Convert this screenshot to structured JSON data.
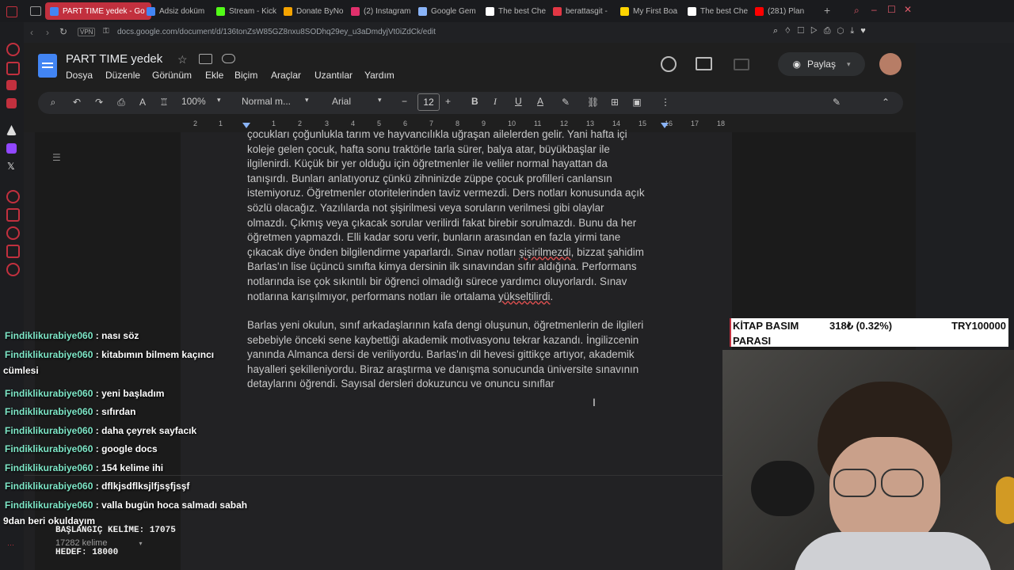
{
  "browser": {
    "tabs": [
      {
        "label": "PART TIME yedek - Go",
        "active": true,
        "color": "#4285f4"
      },
      {
        "label": "Adsiz doküm",
        "color": "#4285f4"
      },
      {
        "label": "Stream - Kick",
        "color": "#53fc18"
      },
      {
        "label": "Donate ByNo",
        "color": "#f4a300"
      },
      {
        "label": "(2) Instagram",
        "color": "#e1306c"
      },
      {
        "label": "Google Gem",
        "color": "#8ab4f8"
      },
      {
        "label": "The best Che",
        "color": "#ffffff"
      },
      {
        "label": "berattasgit -",
        "color": "#e23744"
      },
      {
        "label": "My First Boa",
        "color": "#ffd400"
      },
      {
        "label": "The best Che",
        "color": "#ffffff"
      },
      {
        "label": "(281) Plan",
        "color": "#ff0000"
      }
    ],
    "vpn": "VPN",
    "url": "docs.google.com/document/d/136tonZsW85GZ8nxu8SODhq29ey_u3aDmdyjVt0iZdCk/edit"
  },
  "docs": {
    "title": "PART TIME yedek",
    "menu": [
      "Dosya",
      "Düzenle",
      "Görünüm",
      "Ekle",
      "Biçim",
      "Araçlar",
      "Uzantılar",
      "Yardım"
    ],
    "share_label": "Paylaş",
    "toolbar": {
      "zoom": "100%",
      "style": "Normal m...",
      "font": "Arial",
      "font_size": "12"
    },
    "ruler": [
      "2",
      "1",
      "1",
      "2",
      "3",
      "4",
      "5",
      "6",
      "7",
      "8",
      "9",
      "10",
      "11",
      "12",
      "13",
      "14",
      "15",
      "16",
      "17",
      "18"
    ],
    "paragraph1": [
      "çocukları çoğunlukla tarım ve hayvancılıkla uğraşan ailelerden gelir. Yani hafta içi",
      "koleje gelen çocuk, hafta sonu traktörle tarla sürer, balya atar, büyükbaşlar ile",
      "ilgilenirdi. Küçük bir yer olduğu için öğretmenler ile veliler normal hayattan da",
      "tanışırdı. Bunları anlatıyoruz çünkü zihninizde züppe çocuk profilleri canlansın",
      "istemiyoruz. Öğretmenler otoritelerinden taviz vermezdi. Ders notları konusunda açık",
      "sözlü olacağız. Yazılılarda not şişirilmesi veya soruların verilmesi gibi olaylar",
      "olmazdı. Çıkmış veya çıkacak sorular verilirdi fakat birebir sorulmazdı. Bunu da her",
      "öğretmen yapmazdı. Elli kadar soru verir, bunların arasından en fazla yirmi tane",
      "çıkacak diye önden bilgilendirme yaparlardı. Sınav notları şişirilmezdi, bizzat şahidim",
      "Barlas'ın lise üçüncü sınıfta kimya dersinin ilk sınavından sıfır aldığına. Performans",
      "notlarında ise çok sıkıntılı bir öğrenci olmadığı sürece yardımcı oluyorlardı. Sınav",
      "notlarına karışılmıyor, performans notları ile ortalama yükseltilirdi."
    ],
    "paragraph2": [
      "Barlas yeni okulun, sınıf arkadaşlarının kafa dengi oluşunun, öğretmenlerin de ilgileri",
      "sebebiyle önceki sene kaybettiği akademik motivasyonu tekrar kazandı. İngilizcenin",
      "yanında Almanca dersi de veriliyordu. Barlas'ın dil hevesi gittikçe artıyor, akademik",
      "hayalleri şekilleniyordu. Biraz araştırma ve danışma sonucunda üniversite sınavının",
      "detaylarını öğrendi. Sayısal dersleri dokuzuncu ve onuncu sınıflar"
    ],
    "word_count": "17282 kelime"
  },
  "chat": {
    "messages": [
      {
        "user": "Findiklikurabiye060",
        "text": "nası söz"
      },
      {
        "user": "Findiklikurabiye060",
        "text": "kitabımın bilmem kaçıncı",
        "cont": "cümlesi"
      },
      {
        "user": "Findiklikurabiye060",
        "text": "yeni başladım"
      },
      {
        "user": "Findiklikurabiye060",
        "text": "sıfırdan"
      },
      {
        "user": "Findiklikurabiye060",
        "text": "daha çeyrek sayfacık"
      },
      {
        "user": "Findiklikurabiye060",
        "text": "google docs"
      },
      {
        "user": "Findiklikurabiye060",
        "text": "154 kelime ihi"
      },
      {
        "user": "Findiklikurabiye060",
        "text": "dflkjsdflksjlfjsşfjsşf"
      },
      {
        "user": "Findiklikurabiye060",
        "text": "valla bugün hoca salmadı sabah",
        "cont": "9dan beri okuldayım"
      }
    ],
    "separator": " : "
  },
  "overlay": {
    "start_words": "BAŞLANGIÇ KELİME: 17075",
    "target": "HEDEF: 18000",
    "ticker_label": "KİTAP BASIM",
    "ticker_label2": "PARASI",
    "ticker_value": "318₺ (0.32%)",
    "ticker_goal": "TRY100000"
  }
}
